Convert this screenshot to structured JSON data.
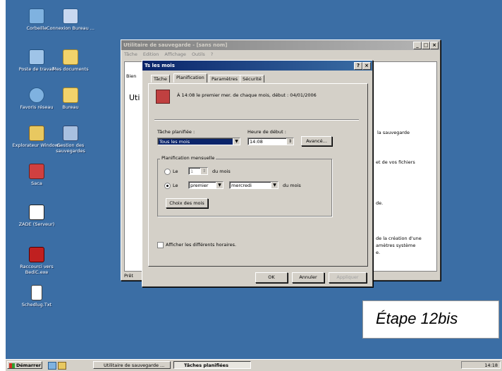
{
  "desktop": {
    "icons": [
      {
        "label": "Corbeille",
        "icon": "recycle-bin-icon"
      },
      {
        "label": "Connexion Bureau ...",
        "icon": "remote-desktop-icon"
      },
      {
        "label": "Poste de travail",
        "icon": "computer-icon"
      },
      {
        "label": "Mes documents",
        "icon": "documents-folder-icon"
      },
      {
        "label": "Favoris réseau",
        "icon": "network-icon"
      },
      {
        "label": "Bureau",
        "icon": "folder-icon"
      },
      {
        "label": "Explorateur Windows",
        "icon": "explorer-icon"
      },
      {
        "label": "Gestion des sauvegardes",
        "icon": "backup-management-icon"
      },
      {
        "label": "Saca",
        "icon": "saca-icon"
      },
      {
        "label": "ZADE (Serveur)",
        "icon": "server-icon"
      },
      {
        "label": "Raccourci vers BediC.exe",
        "icon": "shortcut-b-icon"
      },
      {
        "label": "Schedlug.Txt",
        "icon": "text-file-icon"
      }
    ]
  },
  "backup_window": {
    "title": "Utilitaire de sauvegarde - [sans nom]",
    "menu": [
      "Tâche",
      "Edition",
      "Affichage",
      "Outils",
      "?"
    ],
    "tab_partial": "Bien",
    "heading_partial": "Uti",
    "right_texts": [
      "la sauvegarde",
      "et de vos fichiers",
      "de.",
      "de la création d'une",
      "amètres système",
      "e."
    ],
    "status": "Prêt"
  },
  "dialog": {
    "title": "Ts les mois",
    "tabs": [
      "Tâche",
      "Planification",
      "Paramètres",
      "Sécurité"
    ],
    "summary": "À 14:08 le premier mer. de chaque mois, début : 04/01/2006",
    "planned_task_label": "Tâche planifiée :",
    "planned_task_value": "Tous les mois",
    "start_time_label": "Heure de début :",
    "start_time_value": "14:08",
    "advanced_button": "Avancé...",
    "monthly_group_label": "Planification mensuelle",
    "option1": {
      "prefix": "Le",
      "day_value": "1",
      "suffix": "du mois"
    },
    "option2": {
      "prefix": "Le",
      "ordinal": "premier",
      "weekday": "mercredi",
      "suffix": "du mois"
    },
    "choose_months_button": "Choix des mois",
    "show_multiple_label": "Afficher les différents horaires.",
    "ok_button": "OK",
    "cancel_button": "Annuler",
    "apply_button": "Appliquer"
  },
  "taskbar": {
    "start_label": "Démarrer",
    "items": [
      "Utilitaire de sauvegarde ...",
      "Tâches planifiées"
    ],
    "clock": "14:18"
  },
  "step_label": "Étape 12bis"
}
